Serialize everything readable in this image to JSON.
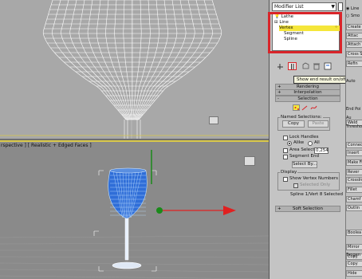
{
  "viewports": {
    "perspective_label": "rspective ] [ Realistic + Edged Faces ]"
  },
  "modifier_panel": {
    "modifier_list": "Modifier List",
    "stack": [
      {
        "label": "Lathe"
      },
      {
        "label": "Line"
      },
      {
        "label": "Vertex"
      },
      {
        "label": "Segment"
      },
      {
        "label": "Spline"
      }
    ],
    "tooltip": "Show end result on/off toggle"
  },
  "rollouts": {
    "rendering": "Rendering",
    "interpolation": "Interpolation",
    "selection": "Selection",
    "soft_selection": "Soft Selection"
  },
  "selection": {
    "named_selections_label": "Named Selections:",
    "copy_button": "Copy",
    "paste_button": "Paste",
    "lock_handles_label": "Lock Handles",
    "alike_label": "Alike",
    "all_label": "All",
    "area_selection_label": "Area Selection:",
    "area_selection_value": "0,254",
    "segment_end_label": "Segment End",
    "select_by_button": "Select By...",
    "display_label": "Display",
    "show_vertex_numbers_label": "Show Vertex Numbers",
    "selected_only_label": "Selected Only",
    "status_text": "Spline 1/Vert 8 Selected"
  },
  "side_panel": {
    "items": [
      {
        "label": "Line",
        "type": "radio"
      },
      {
        "label": "Smo",
        "type": "radio"
      },
      {
        "label": "Create",
        "type": "btn"
      },
      {
        "label": "Attac",
        "type": "btn"
      },
      {
        "label": "Attach M",
        "type": "btn"
      },
      {
        "label": "Cross Se",
        "type": "btn"
      },
      {
        "label": "Refin",
        "type": "btn"
      },
      {
        "label": "Auto",
        "type": "text"
      },
      {
        "label": "Weld",
        "type": "btn"
      },
      {
        "label": "Connec",
        "type": "btn"
      },
      {
        "label": "Insert",
        "type": "btn"
      },
      {
        "label": "Make Fi",
        "type": "btn"
      },
      {
        "label": "Rever",
        "type": "btn"
      },
      {
        "label": "CrossIn",
        "type": "btn"
      },
      {
        "label": "Fillet",
        "type": "btn"
      },
      {
        "label": "Chamf",
        "type": "btn"
      },
      {
        "label": "Outlin",
        "type": "btn"
      },
      {
        "label": "Boolea",
        "type": "btn"
      },
      {
        "label": "Mirror",
        "type": "btn"
      },
      {
        "label": "Copy",
        "type": "btn"
      },
      {
        "label": "Tangen",
        "type": "text"
      },
      {
        "label": "Copy",
        "type": "btn"
      },
      {
        "label": "Hide",
        "type": "btn"
      }
    ],
    "end_point_label": "End Poi",
    "threshold_label": "Thresho",
    "auto_label": "Au"
  },
  "colors": {
    "highlight": "#f5e63a",
    "annotation_red": "#d9252a",
    "gizmo_green": "#1a8a1a",
    "gizmo_red": "#e02020",
    "mesh_blue": "#2f6ed8"
  }
}
